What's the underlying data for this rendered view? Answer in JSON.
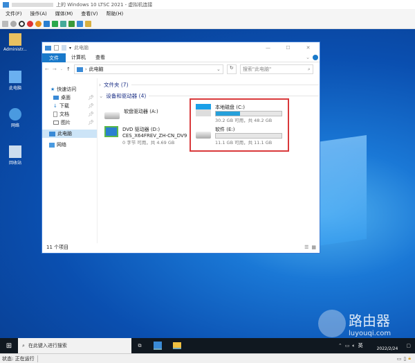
{
  "vm": {
    "title": "上的 Windows 10 LTSC 2021 - 虚拟机连接",
    "menu": [
      "文件(F)",
      "操作(A)",
      "媒体(M)",
      "查看(V)",
      "帮助(H)"
    ],
    "status": "状态: 正在运行"
  },
  "desktop": {
    "icons": [
      "Administr...",
      "此电脑",
      "网络",
      "回收站"
    ],
    "watermark": {
      "text": "路由器",
      "url": "luyouqi.com"
    }
  },
  "explorer": {
    "title": "此电脑",
    "ribbon_tabs": [
      "文件",
      "计算机",
      "查看"
    ],
    "address": "此电脑",
    "search_placeholder": "搜索\"此电脑\"",
    "nav": {
      "quick": "快速访问",
      "items": [
        "桌面",
        "下载",
        "文档",
        "图片"
      ],
      "this_pc": "此电脑",
      "network": "网络"
    },
    "groups": {
      "folders": "文件夹 (7)",
      "devices": "设备和驱动器 (4)"
    },
    "drives": [
      {
        "name": "软盘驱动器 (A:)"
      },
      {
        "name": "DVD 驱动器 (D:)",
        "label": "CES_X64FREV_ZH-CN_DV9",
        "info": "0 字节 可用，共 4.69 GB"
      },
      {
        "name": "本地磁盘 (C:)",
        "info": "30.2 GB 可用，共 48.2 GB",
        "used_fraction": 0.37
      },
      {
        "name": "软件 (E:)",
        "info": "11.1 GB 可用，共 11.1 GB",
        "used_fraction": 0.0
      }
    ],
    "item_count": "11 个项目"
  },
  "taskbar": {
    "search_placeholder": "在此键入进行搜索",
    "ime": "英",
    "date": "2022/2/24"
  },
  "colors": {
    "accent": "#1979ca",
    "highlight_box": "#d9383a"
  }
}
